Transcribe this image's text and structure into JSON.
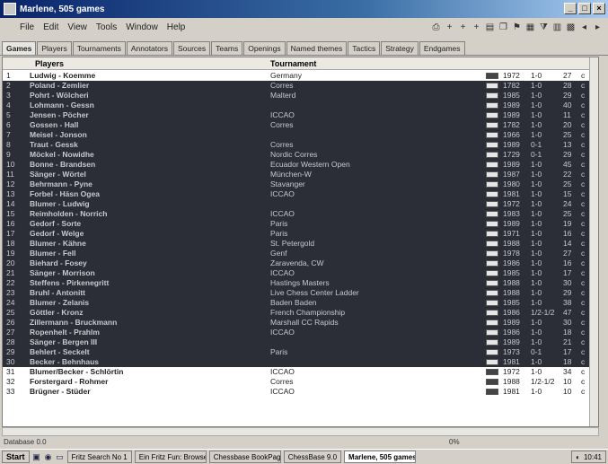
{
  "window": {
    "title": "Marlene, 505 games"
  },
  "menus": [
    "File",
    "Edit",
    "View",
    "Tools",
    "Window",
    "Help"
  ],
  "toolbar_icons": [
    "print-icon",
    "add-icon",
    "add-icon",
    "add-icon",
    "database-icon",
    "copy-icon",
    "flag-icon",
    "database-icon",
    "filter-icon",
    "chart-icon",
    "board-icon",
    "arrow-left-icon",
    "arrow-right-icon"
  ],
  "tabs": [
    "Games",
    "Players",
    "Tournaments",
    "Annotators",
    "Sources",
    "Teams",
    "Openings",
    "Named themes",
    "Tactics",
    "Strategy",
    "Endgames"
  ],
  "columns": {
    "players": "Players",
    "tournament": "Tournament"
  },
  "rows": [
    {
      "num": "1",
      "players": "Ludwig - Koemme",
      "tourn": "Germany",
      "year": "1972",
      "result": "1-0",
      "moves": "27",
      "extra": "c",
      "shade": "light"
    },
    {
      "num": "2",
      "players": "Poland - Zemlier",
      "tourn": "Corres",
      "year": "1782",
      "result": "1-0",
      "moves": "28",
      "extra": "c",
      "shade": "dark"
    },
    {
      "num": "3",
      "players": "Pohrt - Wölcheri",
      "tourn": "Malterd",
      "year": "1985",
      "result": "1-0",
      "moves": "29",
      "extra": "c",
      "shade": "dark"
    },
    {
      "num": "4",
      "players": "Lohmann - Gessn",
      "tourn": "",
      "year": "1989",
      "result": "1-0",
      "moves": "40",
      "extra": "c",
      "shade": "dark"
    },
    {
      "num": "5",
      "players": "Jensen - Pöcher",
      "tourn": "ICCAO",
      "year": "1989",
      "result": "1-0",
      "moves": "11",
      "extra": "c",
      "shade": "dark"
    },
    {
      "num": "6",
      "players": "Gossen - Hall",
      "tourn": "Corres",
      "year": "1782",
      "result": "1-0",
      "moves": "20",
      "extra": "c",
      "shade": "dark"
    },
    {
      "num": "7",
      "players": "Meisel - Jonson",
      "tourn": "",
      "year": "1966",
      "result": "1-0",
      "moves": "25",
      "extra": "c",
      "shade": "dark"
    },
    {
      "num": "8",
      "players": "Traut - Gessk",
      "tourn": "Corres",
      "year": "1989",
      "result": "0-1",
      "moves": "13",
      "extra": "c",
      "shade": "dark"
    },
    {
      "num": "9",
      "players": "Möckel - Nowidhe",
      "tourn": "Nordic Corres",
      "year": "1729",
      "result": "0-1",
      "moves": "29",
      "extra": "c",
      "shade": "dark"
    },
    {
      "num": "10",
      "players": "Bonne - Brandsen",
      "tourn": "Ecuador Western Open",
      "year": "1989",
      "result": "1-0",
      "moves": "45",
      "extra": "c",
      "shade": "dark"
    },
    {
      "num": "11",
      "players": "Sänger - Wörtel",
      "tourn": "München-W",
      "year": "1987",
      "result": "1-0",
      "moves": "22",
      "extra": "c",
      "shade": "dark"
    },
    {
      "num": "12",
      "players": "Behrmann - Pyne",
      "tourn": "Stavanger",
      "year": "1980",
      "result": "1-0",
      "moves": "25",
      "extra": "c",
      "shade": "dark"
    },
    {
      "num": "13",
      "players": "Forbel - Häsn Ogea",
      "tourn": "ICCAO",
      "year": "1981",
      "result": "1-0",
      "moves": "15",
      "extra": "c",
      "shade": "dark"
    },
    {
      "num": "14",
      "players": "Blumer - Ludwig",
      "tourn": "",
      "year": "1972",
      "result": "1-0",
      "moves": "24",
      "extra": "c",
      "shade": "dark"
    },
    {
      "num": "15",
      "players": "Reimholden - Norrich",
      "tourn": "ICCAO",
      "year": "1983",
      "result": "1-0",
      "moves": "25",
      "extra": "c",
      "shade": "dark"
    },
    {
      "num": "16",
      "players": "Gedorf - Sorte",
      "tourn": "Paris",
      "year": "1989",
      "result": "1-0",
      "moves": "19",
      "extra": "c",
      "shade": "dark"
    },
    {
      "num": "17",
      "players": "Gedorf - Welge",
      "tourn": "Paris",
      "year": "1971",
      "result": "1-0",
      "moves": "16",
      "extra": "c",
      "shade": "dark"
    },
    {
      "num": "18",
      "players": "Blumer - Kähne",
      "tourn": "St. Petergold",
      "year": "1988",
      "result": "1-0",
      "moves": "14",
      "extra": "c",
      "shade": "dark"
    },
    {
      "num": "19",
      "players": "Blumer - Fell",
      "tourn": "Genf",
      "year": "1978",
      "result": "1-0",
      "moves": "27",
      "extra": "c",
      "shade": "dark"
    },
    {
      "num": "20",
      "players": "Biehard - Fosey",
      "tourn": "Zaravenda, CW",
      "year": "1986",
      "result": "1-0",
      "moves": "16",
      "extra": "c",
      "shade": "dark"
    },
    {
      "num": "21",
      "players": "Sänger - Morrison",
      "tourn": "ICCAO",
      "year": "1985",
      "result": "1-0",
      "moves": "17",
      "extra": "c",
      "shade": "dark"
    },
    {
      "num": "22",
      "players": "Steffens - Pirkenegritt",
      "tourn": "Hastings Masters",
      "year": "1988",
      "result": "1-0",
      "moves": "30",
      "extra": "c",
      "shade": "dark"
    },
    {
      "num": "23",
      "players": "Bruhl - Antonitt",
      "tourn": "Live Chess Center Ladder",
      "year": "1988",
      "result": "1-0",
      "moves": "29",
      "extra": "c",
      "shade": "dark"
    },
    {
      "num": "24",
      "players": "Blumer - Zelanis",
      "tourn": "Baden Baden",
      "year": "1985",
      "result": "1-0",
      "moves": "38",
      "extra": "c",
      "shade": "dark"
    },
    {
      "num": "25",
      "players": "Göttler - Kronz",
      "tourn": "French Championship",
      "year": "1986",
      "result": "1/2-1/2",
      "moves": "47",
      "extra": "c",
      "shade": "dark"
    },
    {
      "num": "26",
      "players": "Zillermann - Bruckmann",
      "tourn": "Marshall CC Rapids",
      "year": "1989",
      "result": "1-0",
      "moves": "30",
      "extra": "c",
      "shade": "dark"
    },
    {
      "num": "27",
      "players": "Ropenhelt - Prahlm",
      "tourn": "ICCAO",
      "year": "1986",
      "result": "1-0",
      "moves": "18",
      "extra": "c",
      "shade": "dark"
    },
    {
      "num": "28",
      "players": "Sänger - Bergen III",
      "tourn": "",
      "year": "1989",
      "result": "1-0",
      "moves": "21",
      "extra": "c",
      "shade": "dark"
    },
    {
      "num": "29",
      "players": "Behlert - Seckelt",
      "tourn": "Paris",
      "year": "1973",
      "result": "0-1",
      "moves": "17",
      "extra": "c",
      "shade": "dark"
    },
    {
      "num": "30",
      "players": "Becker - Behnhaus",
      "tourn": "",
      "year": "1981",
      "result": "1-0",
      "moves": "18",
      "extra": "c",
      "shade": "dark"
    },
    {
      "num": "31",
      "players": "Blumer/Becker - Schlörtin",
      "tourn": "ICCAO",
      "year": "1972",
      "result": "1-0",
      "moves": "34",
      "extra": "c",
      "shade": "light"
    },
    {
      "num": "32",
      "players": "Forstergard - Rohmer",
      "tourn": "Corres",
      "year": "1988",
      "result": "1/2-1/2",
      "moves": "10",
      "extra": "c",
      "shade": "light"
    },
    {
      "num": "33",
      "players": "Brügner - Stüder",
      "tourn": "ICCAO",
      "year": "1981",
      "result": "1-0",
      "moves": "10",
      "extra": "c",
      "shade": "light"
    }
  ],
  "status": {
    "left": "Database 0.0",
    "right": "0%"
  },
  "taskbar": {
    "start": "Start",
    "items": [
      "Fritz Search No 1",
      "Ein Fritz Fun: Browser",
      "Chessbase BookPage 10.1",
      "ChessBase 9.0",
      "Marlene, 505 games"
    ],
    "active_index": 4,
    "clock": "10:41"
  }
}
